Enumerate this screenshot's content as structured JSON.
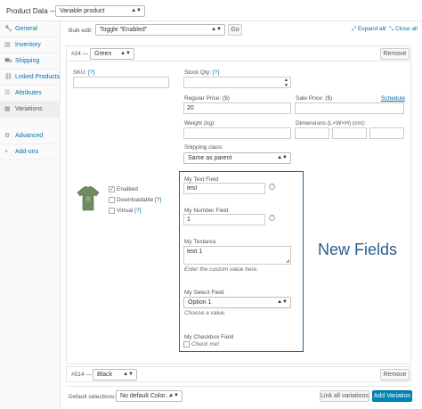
{
  "header": {
    "title": "Product Data —",
    "product_type": "Variable product"
  },
  "sidebar": {
    "items": [
      {
        "label": "General",
        "icon": "wrench-icon",
        "glyph": "🔧"
      },
      {
        "label": "Inventory",
        "icon": "clipboard-icon",
        "glyph": "▤"
      },
      {
        "label": "Shipping",
        "icon": "truck-icon",
        "glyph": "⛟"
      },
      {
        "label": "Linked Products",
        "icon": "link-icon",
        "glyph": "⛓"
      },
      {
        "label": "Attributes",
        "icon": "list-icon",
        "glyph": "☰"
      },
      {
        "label": "Variations",
        "icon": "grid-icon",
        "glyph": "▦"
      },
      {
        "label": "Advanced",
        "icon": "gear-icon",
        "glyph": "⚙"
      },
      {
        "label": "Add-ons",
        "icon": "plus-icon",
        "glyph": "+"
      }
    ],
    "active_index": 5
  },
  "toolbar": {
    "bulk_edit_label": "Bulk edit:",
    "bulk_edit_value": "Toggle \"Enabled\"",
    "go_label": "Go",
    "expand_all": "Expand all",
    "close_all": "Close all",
    "separator": "/"
  },
  "variation1": {
    "id_label": "#24 —",
    "attribute_value": "Green",
    "remove_label": "Remove",
    "sku_label": "SKU:",
    "help_marker": "[?]",
    "stock_qty_label": "Stock Qty:",
    "regular_price_label": "Regular Price: ($)",
    "regular_price_value": "20",
    "sale_price_label": "Sale Price: ($)",
    "schedule_label": "Schedule",
    "weight_label": "Weight (kg):",
    "dimensions_label": "Dimensions (L×W×H) (cm):",
    "shipping_class_label": "Shipping class:",
    "shipping_class_value": "Same as parent",
    "enabled_label": "Enabled",
    "downloadable_label": "Downloadable",
    "virtual_label": "Virtual",
    "enabled_checked": true,
    "downloadable_checked": false,
    "virtual_checked": false,
    "custom": {
      "text_field_label": "My Text Field",
      "text_field_value": "test",
      "number_field_label": "My Number Field",
      "number_field_value": "1",
      "textarea_label": "My Textarea",
      "textarea_value": "text 1",
      "textarea_hint": "Enter the custom value here.",
      "select_label": "My Select Field",
      "select_value": "Option 1",
      "select_hint": "Choose a value.",
      "checkbox_label": "My Checkbox Field",
      "checkbox_text": "Check me!",
      "checkbox_checked": false
    },
    "callout_text": "New Fields",
    "callout_color": "#2c5f8a"
  },
  "variation2": {
    "id_label": "#514 —",
    "attribute_value": "Black",
    "remove_label": "Remove"
  },
  "footer": {
    "default_selections_label": "Default selections:",
    "default_selections_value": "No default Color...",
    "link_all_label": "Link all variations",
    "add_variation_label": "Add Variation"
  }
}
